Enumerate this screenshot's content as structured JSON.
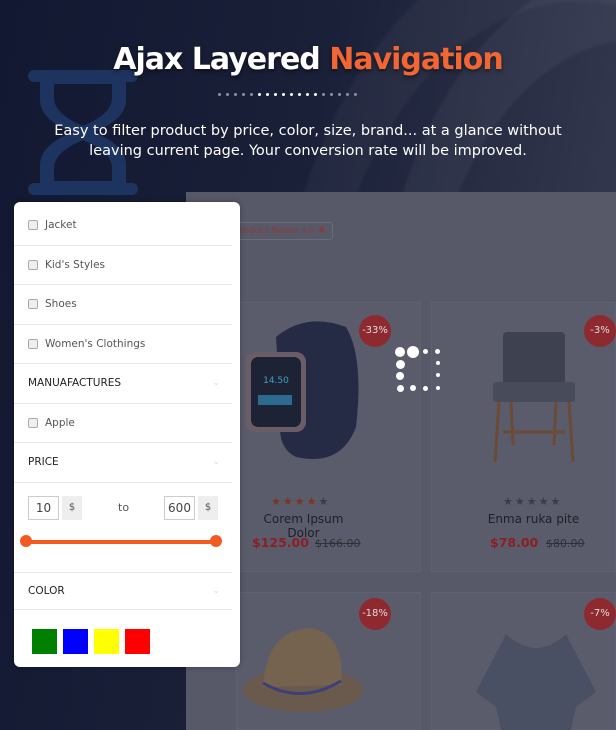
{
  "hero": {
    "title_main": "Ajax Layered ",
    "title_accent": "Navigation",
    "subtitle_line1": "Easy to filter product by price, color, size, brand... at a glance without",
    "subtitle_line2": "leaving current page. Your conversion rate will be improved.",
    "accent_color": "#f26634"
  },
  "shop": {
    "sort_chip": "d Product Name +/-",
    "section_fragment": "s",
    "products": [
      {
        "name": "Corem Ipsum Dolor",
        "price": "$125.00",
        "old_price": "$166.00",
        "discount": "-33%",
        "rating": 4
      },
      {
        "name": "Enma ruka pite",
        "price": "$78.00",
        "old_price": "$80.00",
        "discount": "-3%",
        "rating": 0
      },
      {
        "discount": "-18%"
      },
      {
        "discount": "-7%"
      }
    ]
  },
  "sidebar": {
    "categories": [
      "Jacket",
      "Kid's Styles",
      "Shoes",
      "Women's Clothings"
    ],
    "manufactures_label": "MANUAFACTURES",
    "manufacturers": [
      "Apple"
    ],
    "price_label": "PRICE",
    "price_min": "10",
    "price_max": "600",
    "currency": "$",
    "to_label": "to",
    "color_label": "COLOR",
    "colors": [
      "#008000",
      "#0000ff",
      "#ffff00",
      "#ff0000"
    ]
  }
}
